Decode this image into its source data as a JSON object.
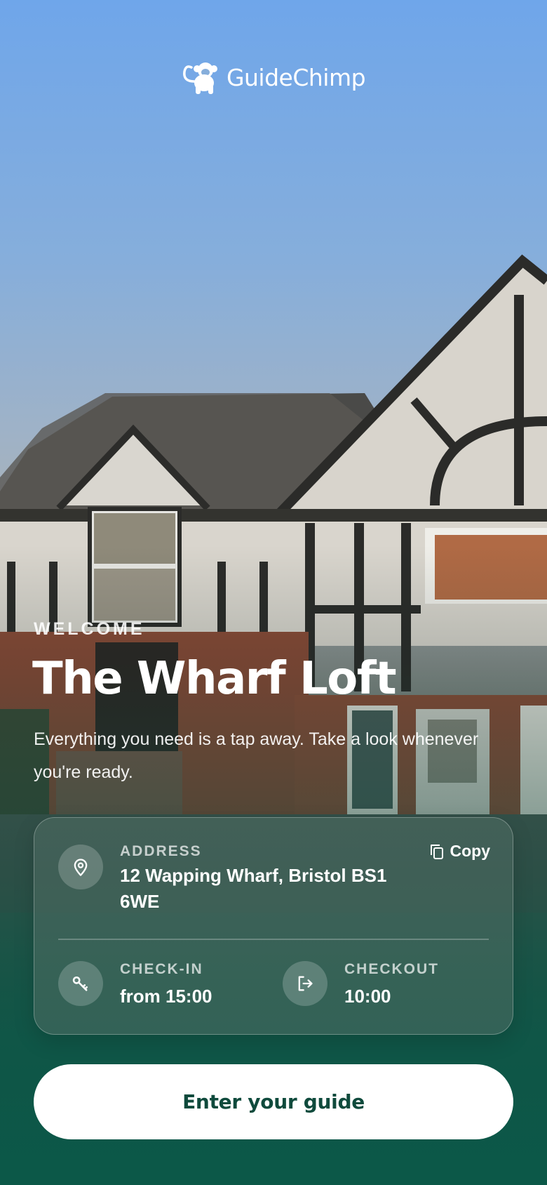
{
  "brand": {
    "name": "GuideChimp",
    "logo_icon": "monkey-icon"
  },
  "hero": {
    "eyebrow": "WELCOME",
    "title": "The Wharf Loft",
    "subtitle": "Everything you need is a tap away. Take a look whenever you're ready."
  },
  "details": {
    "address": {
      "label": "ADDRESS",
      "value": "12 Wapping Wharf, Bristol BS1 6WE",
      "icon": "location-pin-icon",
      "copy_label": "Copy",
      "copy_icon": "copy-icon"
    },
    "check_in": {
      "label": "CHECK-IN",
      "value": "from 15:00",
      "icon": "key-icon"
    },
    "checkout": {
      "label": "CHECKOUT",
      "value": "10:00",
      "icon": "logout-icon"
    }
  },
  "cta": {
    "label": "Enter your guide"
  },
  "colors": {
    "accent": "#0f4a3c",
    "sky": "#6fa6ea",
    "footer": "#0f5a4a"
  }
}
